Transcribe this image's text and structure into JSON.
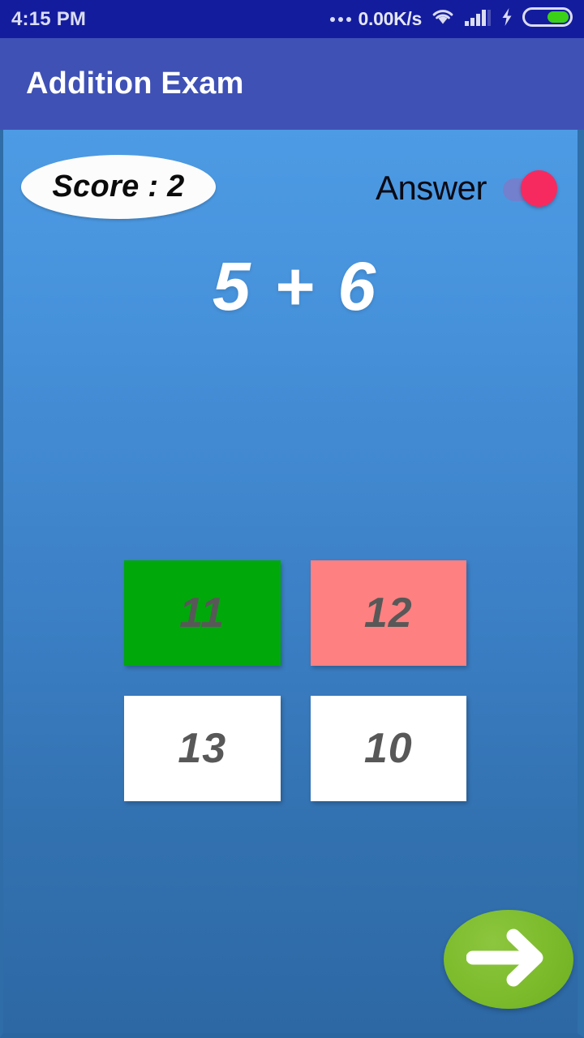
{
  "statusbar": {
    "time": "4:15 PM",
    "network_speed": "0.00K/s",
    "dots_icon": "more-horizontal-icon",
    "wifi_icon": "wifi-icon",
    "signal_icon": "cellular-signal-icon",
    "charging_icon": "lightning-bolt-icon",
    "battery_icon": "battery-icon",
    "background_color": "#141C9E",
    "text_color": "#DADCF2",
    "battery_fill_color": "#3BD118"
  },
  "appbar": {
    "title": "Addition Exam",
    "background_color": "#3F51B5",
    "title_color": "#FFFFFF"
  },
  "content": {
    "background_top_color": "#4D9BE4",
    "background_bottom_color": "#2D68A4"
  },
  "score": {
    "label": "Score : 2",
    "badge_color": "#FCFCFC",
    "text_color": "#0B0B0B"
  },
  "answer_toggle": {
    "label": "Answer",
    "state": "on",
    "track_color": "#7A7BC9",
    "thumb_color": "#F72A5F"
  },
  "question": {
    "text": "5 + 6"
  },
  "options": [
    {
      "value": "11",
      "background_color": "#00A80A",
      "text_color": "#585858",
      "state": "correct"
    },
    {
      "value": "12",
      "background_color": "#FF8080",
      "text_color": "#585858",
      "state": "wrong"
    },
    {
      "value": "13",
      "background_color": "#FFFFFF",
      "text_color": "#585858",
      "state": "default"
    },
    {
      "value": "10",
      "background_color": "#FFFFFF",
      "text_color": "#585858",
      "state": "default"
    }
  ],
  "next_button": {
    "icon": "arrow-right-icon",
    "background_color": "#7CBB2B",
    "icon_color": "#FFFFFF"
  }
}
